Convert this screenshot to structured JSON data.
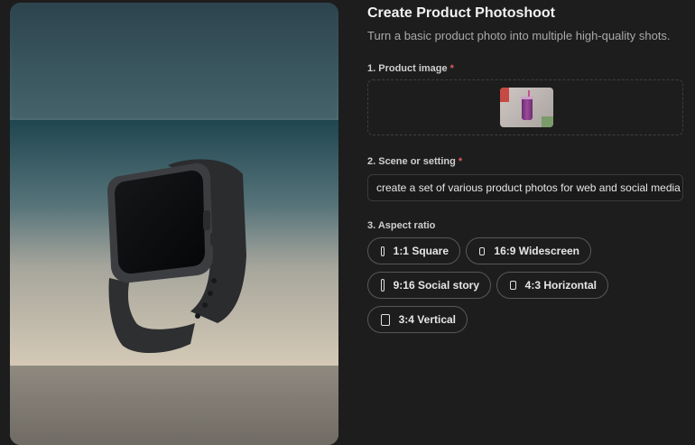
{
  "header": {
    "title": "Create Product Photoshoot",
    "subtitle": "Turn a basic product photo into multiple high-quality shots."
  },
  "product_image": {
    "label": "1. Product image",
    "required_mark": "*"
  },
  "scene": {
    "label": "2. Scene or setting",
    "required_mark": "*",
    "value": "create a set of various product photos for web and social media"
  },
  "aspect_ratio": {
    "label": "3. Aspect ratio",
    "options": [
      {
        "label": "1:1 Square",
        "icon": "square-icon"
      },
      {
        "label": "16:9 Widescreen",
        "icon": "widescreen-icon"
      },
      {
        "label": "9:16 Social story",
        "icon": "portrait-icon"
      },
      {
        "label": "4:3 Horizontal",
        "icon": "horizontal-icon"
      },
      {
        "label": "3:4 Vertical",
        "icon": "vertical-icon"
      }
    ]
  }
}
